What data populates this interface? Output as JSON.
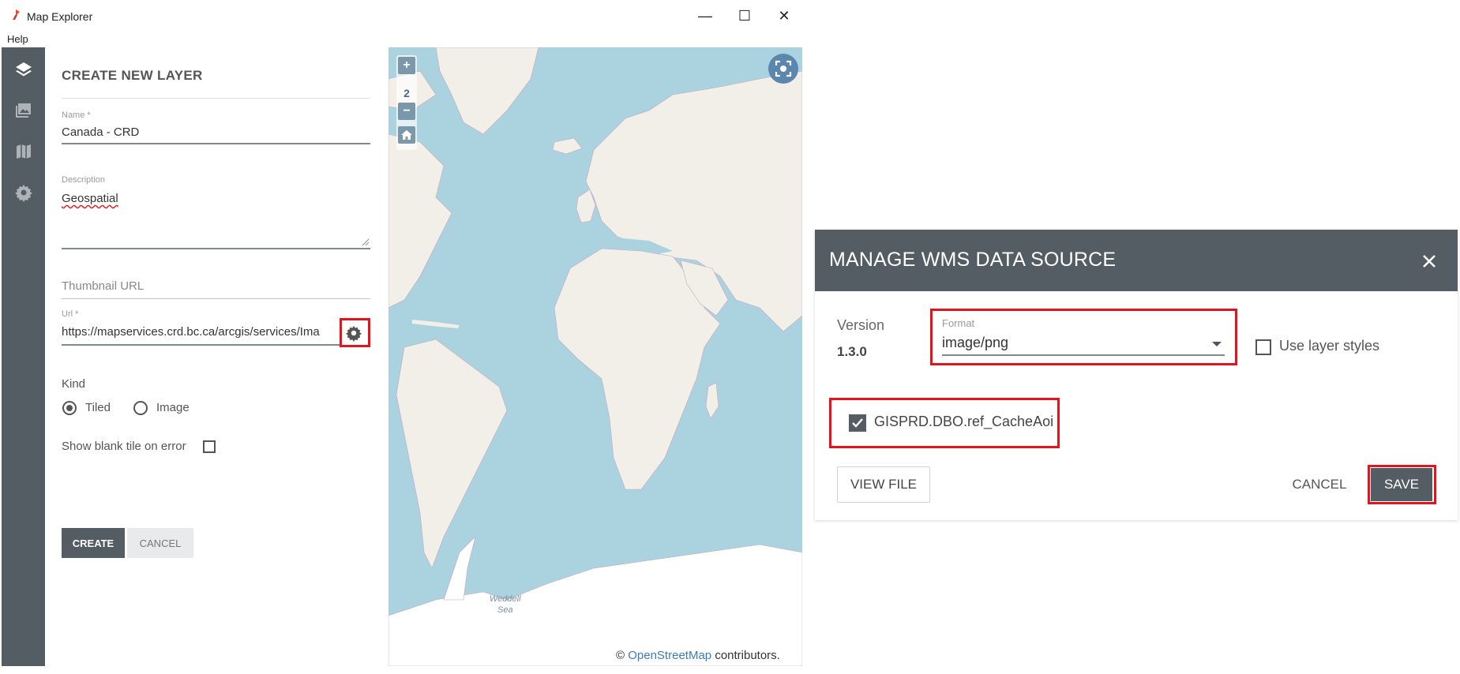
{
  "window": {
    "title": "Map Explorer",
    "minimize_glyph": "—",
    "maximize_glyph": "☐",
    "close_glyph": "✕"
  },
  "menu": {
    "help": "Help"
  },
  "rail": {
    "icons": [
      "layers-icon",
      "image-gallery-icon",
      "map-icon",
      "gear-icon"
    ]
  },
  "form": {
    "title": "CREATE NEW LAYER",
    "name_label": "Name *",
    "name_value": "Canada - CRD",
    "description_label": "Description",
    "description_value": "Geospatial",
    "thumbnail_placeholder": "Thumbnail URL",
    "url_label": "Url *",
    "url_value": "https://mapservices.crd.bc.ca/arcgis/services/Ima",
    "kind_label": "Kind",
    "kind_options": [
      "Tiled",
      "Image"
    ],
    "kind_selected": "Tiled",
    "blank_tile_label": "Show blank tile on error",
    "blank_tile_checked": false,
    "create_label": "CREATE",
    "cancel_label": "CANCEL"
  },
  "map": {
    "zoom_in": "+",
    "zoom_level": "2",
    "zoom_out": "−",
    "sea_label_1": "Weddell",
    "sea_label_2": "Sea",
    "attribution_prefix": "©",
    "attribution_link": "OpenStreetMap",
    "attribution_suffix": "contributors.",
    "colors": {
      "water": "#aad3df",
      "land": "#f2efe9",
      "ice": "#ffffff",
      "border": "#c7a6c0"
    }
  },
  "dialog": {
    "title": "MANAGE WMS DATA SOURCE",
    "version_label": "Version",
    "version_value": "1.3.0",
    "format_label": "Format",
    "format_value": "image/png",
    "use_layer_styles_label": "Use layer styles",
    "use_layer_styles_checked": false,
    "layer_name": "GISPRD.DBO.ref_CacheAoi",
    "layer_checked": true,
    "view_file_label": "VIEW FILE",
    "cancel_label": "CANCEL",
    "save_label": "SAVE"
  },
  "colors": {
    "rail": "#545c64",
    "primary_button": "#545c64",
    "highlight": "#e3141b",
    "link": "#3b7bc0"
  }
}
